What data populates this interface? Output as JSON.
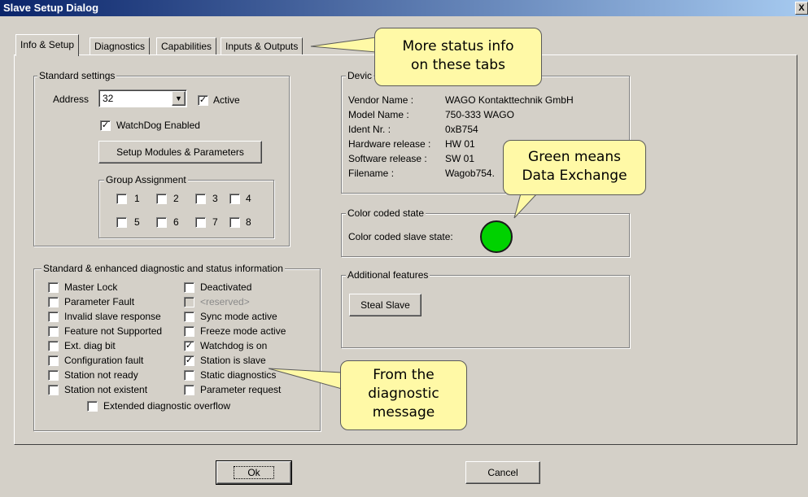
{
  "window": {
    "title": "Slave Setup Dialog",
    "close_glyph": "X"
  },
  "tabs": [
    "Info & Setup",
    "Diagnostics",
    "Capabilities",
    "Inputs & Outputs"
  ],
  "standard_settings": {
    "legend": "Standard settings",
    "address_label": "Address",
    "address_value": "32",
    "active_label": "Active",
    "active_checked": true,
    "watchdog_label": "WatchDog Enabled",
    "watchdog_checked": true,
    "setup_button": "Setup Modules & Parameters",
    "group_assignment": {
      "legend": "Group Assignment",
      "groups": [
        "1",
        "2",
        "3",
        "4",
        "5",
        "6",
        "7",
        "8"
      ]
    }
  },
  "diagnostics": {
    "legend": "Standard & enhanced diagnostic and status information",
    "left": [
      {
        "label": "Master Lock",
        "checked": false
      },
      {
        "label": "Parameter Fault",
        "checked": false
      },
      {
        "label": "Invalid slave response",
        "checked": false
      },
      {
        "label": "Feature not Supported",
        "checked": false
      },
      {
        "label": "Ext. diag bit",
        "checked": false
      },
      {
        "label": "Configuration fault",
        "checked": false
      },
      {
        "label": "Station not ready",
        "checked": false
      },
      {
        "label": "Station not existent",
        "checked": false
      }
    ],
    "right": [
      {
        "label": "Deactivated",
        "checked": false
      },
      {
        "label": "<reserved>",
        "checked": false,
        "disabled": true
      },
      {
        "label": "Sync mode active",
        "checked": false
      },
      {
        "label": "Freeze mode active",
        "checked": false
      },
      {
        "label": "Watchdog is on",
        "checked": true
      },
      {
        "label": "Station is slave",
        "checked": true
      },
      {
        "label": "Static diagnostics",
        "checked": false
      },
      {
        "label": "Parameter request",
        "checked": false
      }
    ],
    "overflow_label": "Extended diagnostic overflow"
  },
  "device": {
    "legend": "Devic",
    "fields": [
      {
        "label": "Vendor Name :",
        "value": "WAGO Kontakttechnik GmbH"
      },
      {
        "label": "Model Name :",
        "value": "750-333 WAGO"
      },
      {
        "label": "Ident Nr. :",
        "value": "0xB754"
      },
      {
        "label": "Hardware release :",
        "value": "HW 01"
      },
      {
        "label": "Software release :",
        "value": "SW 01"
      },
      {
        "label": "Filename :",
        "value": "Wagob754."
      }
    ]
  },
  "color_state": {
    "legend": "Color coded state",
    "label": "Color coded slave state:",
    "state_color": "#00d200"
  },
  "additional": {
    "legend": "Additional features",
    "steal_button": "Steal Slave"
  },
  "footer": {
    "ok": "Ok",
    "cancel": "Cancel"
  },
  "callouts": {
    "tabs": [
      "More status info",
      "on these tabs"
    ],
    "green": [
      "Green means",
      "Data Exchange"
    ],
    "diag": [
      "From the",
      "diagnostic",
      "message"
    ]
  }
}
